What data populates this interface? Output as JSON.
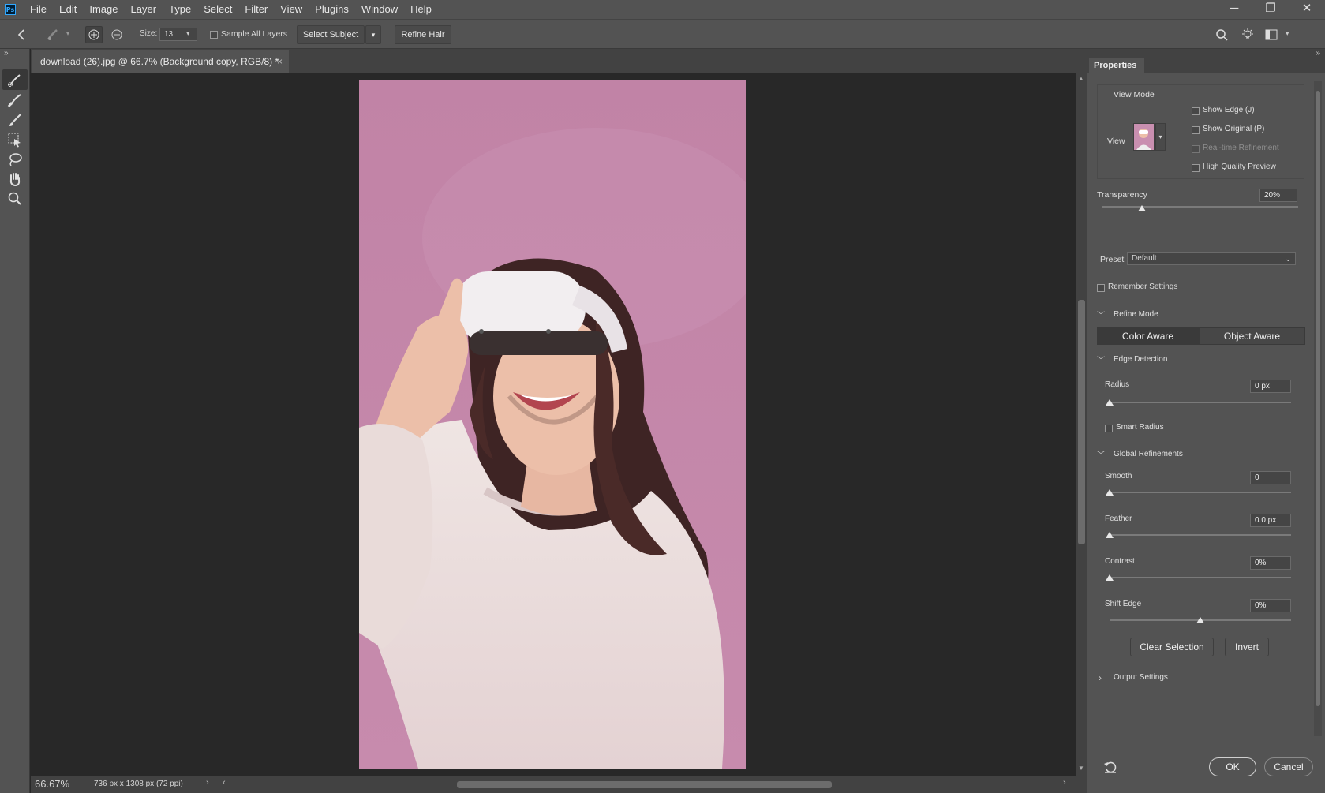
{
  "menubar": {
    "logo": "Ps",
    "items": [
      "File",
      "Edit",
      "Image",
      "Layer",
      "Type",
      "Select",
      "Filter",
      "View",
      "Plugins",
      "Window",
      "Help"
    ]
  },
  "window_controls": {
    "minimize": "─",
    "restore": "❐",
    "close": "✕"
  },
  "options": {
    "size_label": "Size:",
    "size_value": "13",
    "sample_all_layers": "Sample All Layers",
    "select_subject": "Select Subject",
    "refine_hair": "Refine Hair"
  },
  "document": {
    "tab_title": "download (26).jpg @ 66.7% (Background copy, RGB/8) *",
    "close": "×"
  },
  "status": {
    "zoom": "66.67%",
    "dimensions": "736 px x 1308 px (72 ppi)"
  },
  "panel": {
    "title": "Properties",
    "view_mode_label": "View Mode",
    "view_label": "View",
    "show_edge": "Show Edge (J)",
    "show_original": "Show Original (P)",
    "realtime_refinement": "Real-time Refinement",
    "high_quality_preview": "High Quality Preview",
    "transparency_label": "Transparency",
    "transparency_value": "20%",
    "transparency_fraction": 0.2,
    "preset_label": "Preset",
    "preset_value": "Default",
    "remember_settings": "Remember Settings",
    "refine_mode_label": "Refine Mode",
    "color_aware": "Color Aware",
    "object_aware": "Object Aware",
    "edge_detection_label": "Edge Detection",
    "radius_label": "Radius",
    "radius_value": "0 px",
    "smart_radius": "Smart Radius",
    "global_refinements_label": "Global Refinements",
    "smooth_label": "Smooth",
    "smooth_value": "0",
    "feather_label": "Feather",
    "feather_value": "0.0 px",
    "contrast_label": "Contrast",
    "contrast_value": "0%",
    "shift_edge_label": "Shift Edge",
    "shift_edge_value": "0%",
    "clear_selection": "Clear Selection",
    "invert": "Invert",
    "output_settings_label": "Output Settings",
    "ok": "OK",
    "cancel": "Cancel"
  }
}
